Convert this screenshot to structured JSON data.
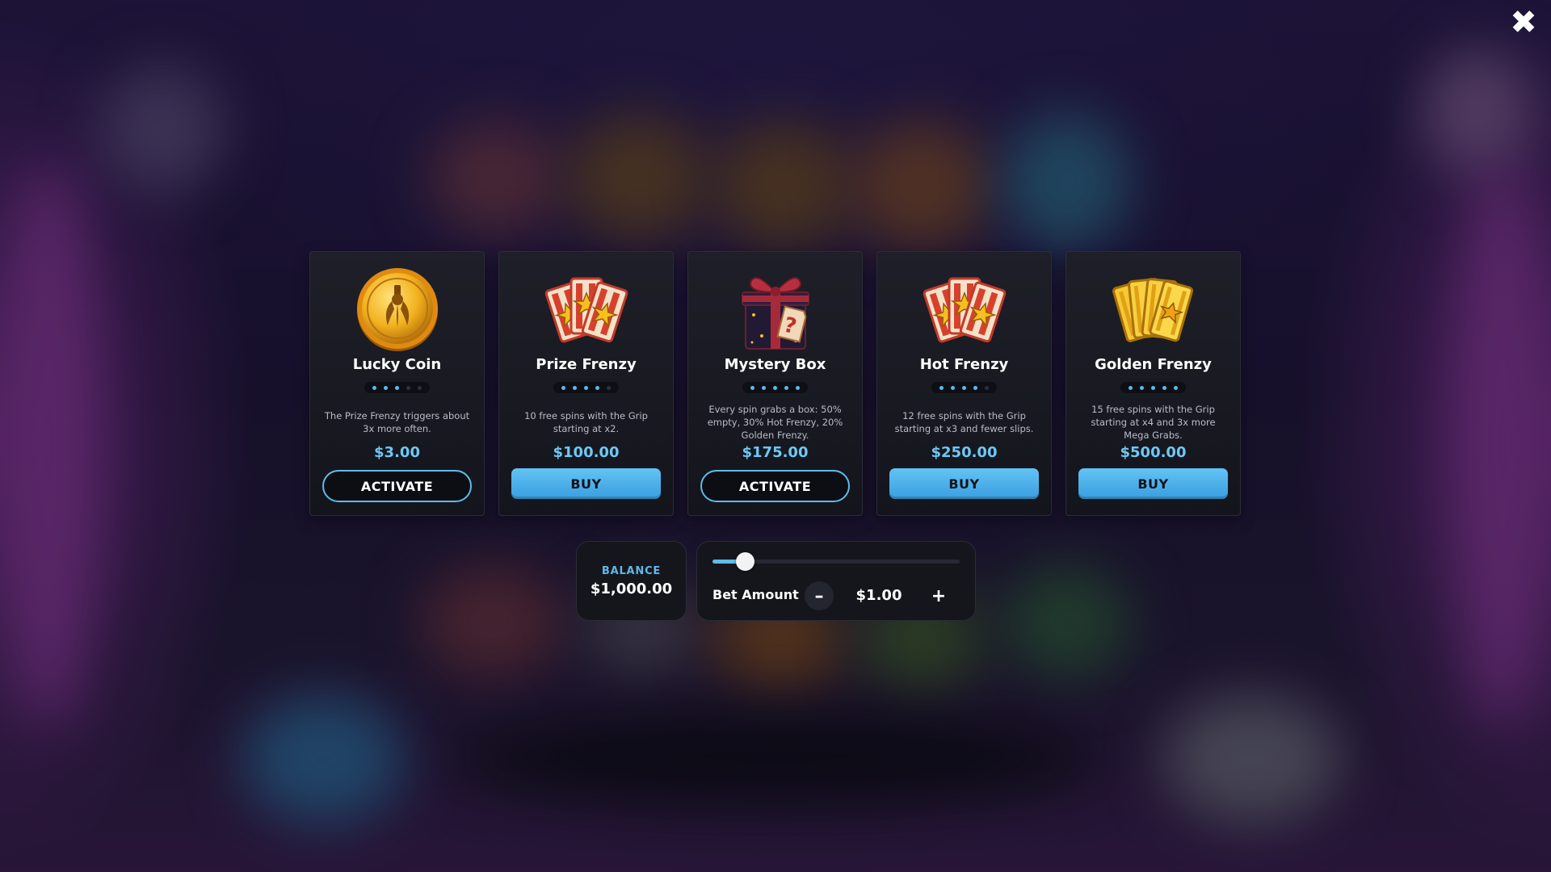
{
  "close_label": "✖",
  "cards": [
    {
      "title": "Lucky Coin",
      "icon": "coin-claw-icon",
      "rating": 3,
      "rating_max": 5,
      "description": "The Prize Frenzy triggers about 3x more often.",
      "price": "$3.00",
      "button": "ACTIVATE",
      "button_style": "outline"
    },
    {
      "title": "Prize Frenzy",
      "icon": "red-tickets-icon",
      "rating": 4,
      "rating_max": 5,
      "description": "10 free spins with the Grip starting at x2.",
      "price": "$100.00",
      "button": "BUY",
      "button_style": "solid"
    },
    {
      "title": "Mystery Box",
      "icon": "mystery-gift-box-icon",
      "rating": 5,
      "rating_max": 5,
      "description": "Every spin grabs a box: 50% empty, 30% Hot Frenzy, 20% Golden Frenzy.",
      "price": "$175.00",
      "button": "ACTIVATE",
      "button_style": "outline"
    },
    {
      "title": "Hot Frenzy",
      "icon": "red-tickets-icon",
      "rating": 4,
      "rating_max": 5,
      "description": "12 free spins with the Grip starting at x3 and fewer slips.",
      "price": "$250.00",
      "button": "BUY",
      "button_style": "solid"
    },
    {
      "title": "Golden Frenzy",
      "icon": "golden-tickets-icon",
      "rating": 5,
      "rating_max": 5,
      "description": "15 free spins with the Grip starting at x4 and 3x more Mega Grabs.",
      "price": "$500.00",
      "button": "BUY",
      "button_style": "solid"
    }
  ],
  "balance": {
    "label": "BALANCE",
    "value": "$1,000.00"
  },
  "bet": {
    "label": "Bet Amount",
    "value": "$1.00",
    "minus": "–",
    "plus": "+",
    "slider_fraction": 0.13
  },
  "colors": {
    "accent": "#5fbce9",
    "price": "#6ec8f5",
    "card_bg": "#1a1b23"
  }
}
